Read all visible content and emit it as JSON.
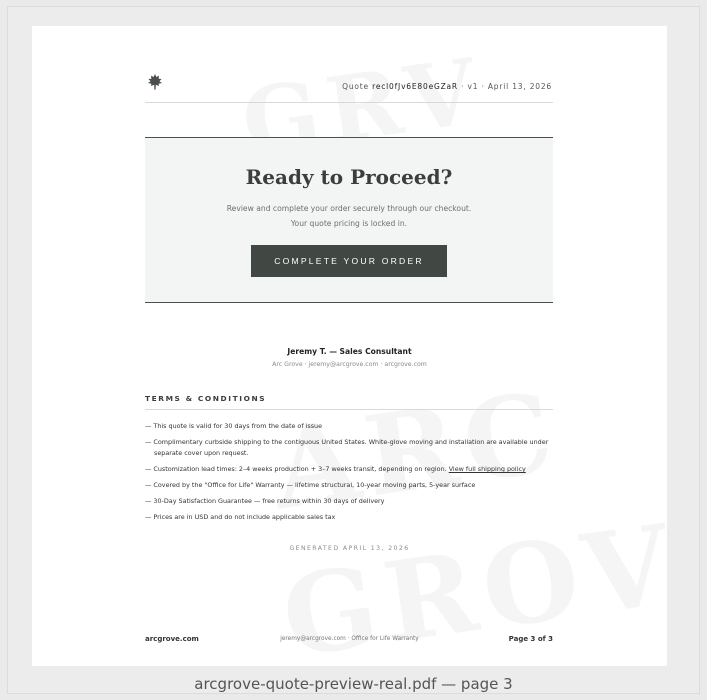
{
  "header": {
    "quote_label": "Quote",
    "quote_id": "recl0fJv6E80eGZaR",
    "version": "v1",
    "date": "April 13, 2026",
    "separator": "·"
  },
  "cta": {
    "title": "Ready to Proceed?",
    "line1": "Review and complete your order securely through our checkout.",
    "line2": "Your quote pricing is locked in.",
    "button_label": "COMPLETE YOUR ORDER"
  },
  "consultant": {
    "name": "Jeremy T. — Sales Consultant",
    "info": "Arc Grove · jeremy@arcgrove.com · arcgrove.com"
  },
  "terms": {
    "heading": "TERMS & CONDITIONS",
    "items": [
      "— This quote is valid for 30 days from the date of issue",
      "— Complimentary curbside shipping to the contiguous United States. White-glove moving and installation are available under separate cover upon request.",
      "— Customization lead times: 2–4 weeks production + 3–7 weeks transit, depending on region.",
      "— Covered by the \"Office for Life\" Warranty — lifetime structural, 10-year moving parts, 5-year surface",
      "— 30-Day Satisfaction Guarantee — free returns within 30 days of delivery",
      "— Prices are in USD and do not include applicable sales tax"
    ],
    "shipping_link": "View full shipping policy"
  },
  "generated": "GENERATED APRIL 13, 2026",
  "footer": {
    "site": "arcgrove.com",
    "center": "jeremy@arcgrove.com · Office for Life Warranty",
    "page": "Page 3 of 3"
  },
  "watermark": {
    "line1": "GRV",
    "line2": "ARC",
    "line3": "GROV"
  },
  "caption": "arcgrove-quote-preview-real.pdf — page 3",
  "colors": {
    "button": "#414843",
    "cta_bg": "#f3f5f4",
    "rule": "#4a504d"
  },
  "icons": {
    "logo": "leaf-logo-icon"
  }
}
